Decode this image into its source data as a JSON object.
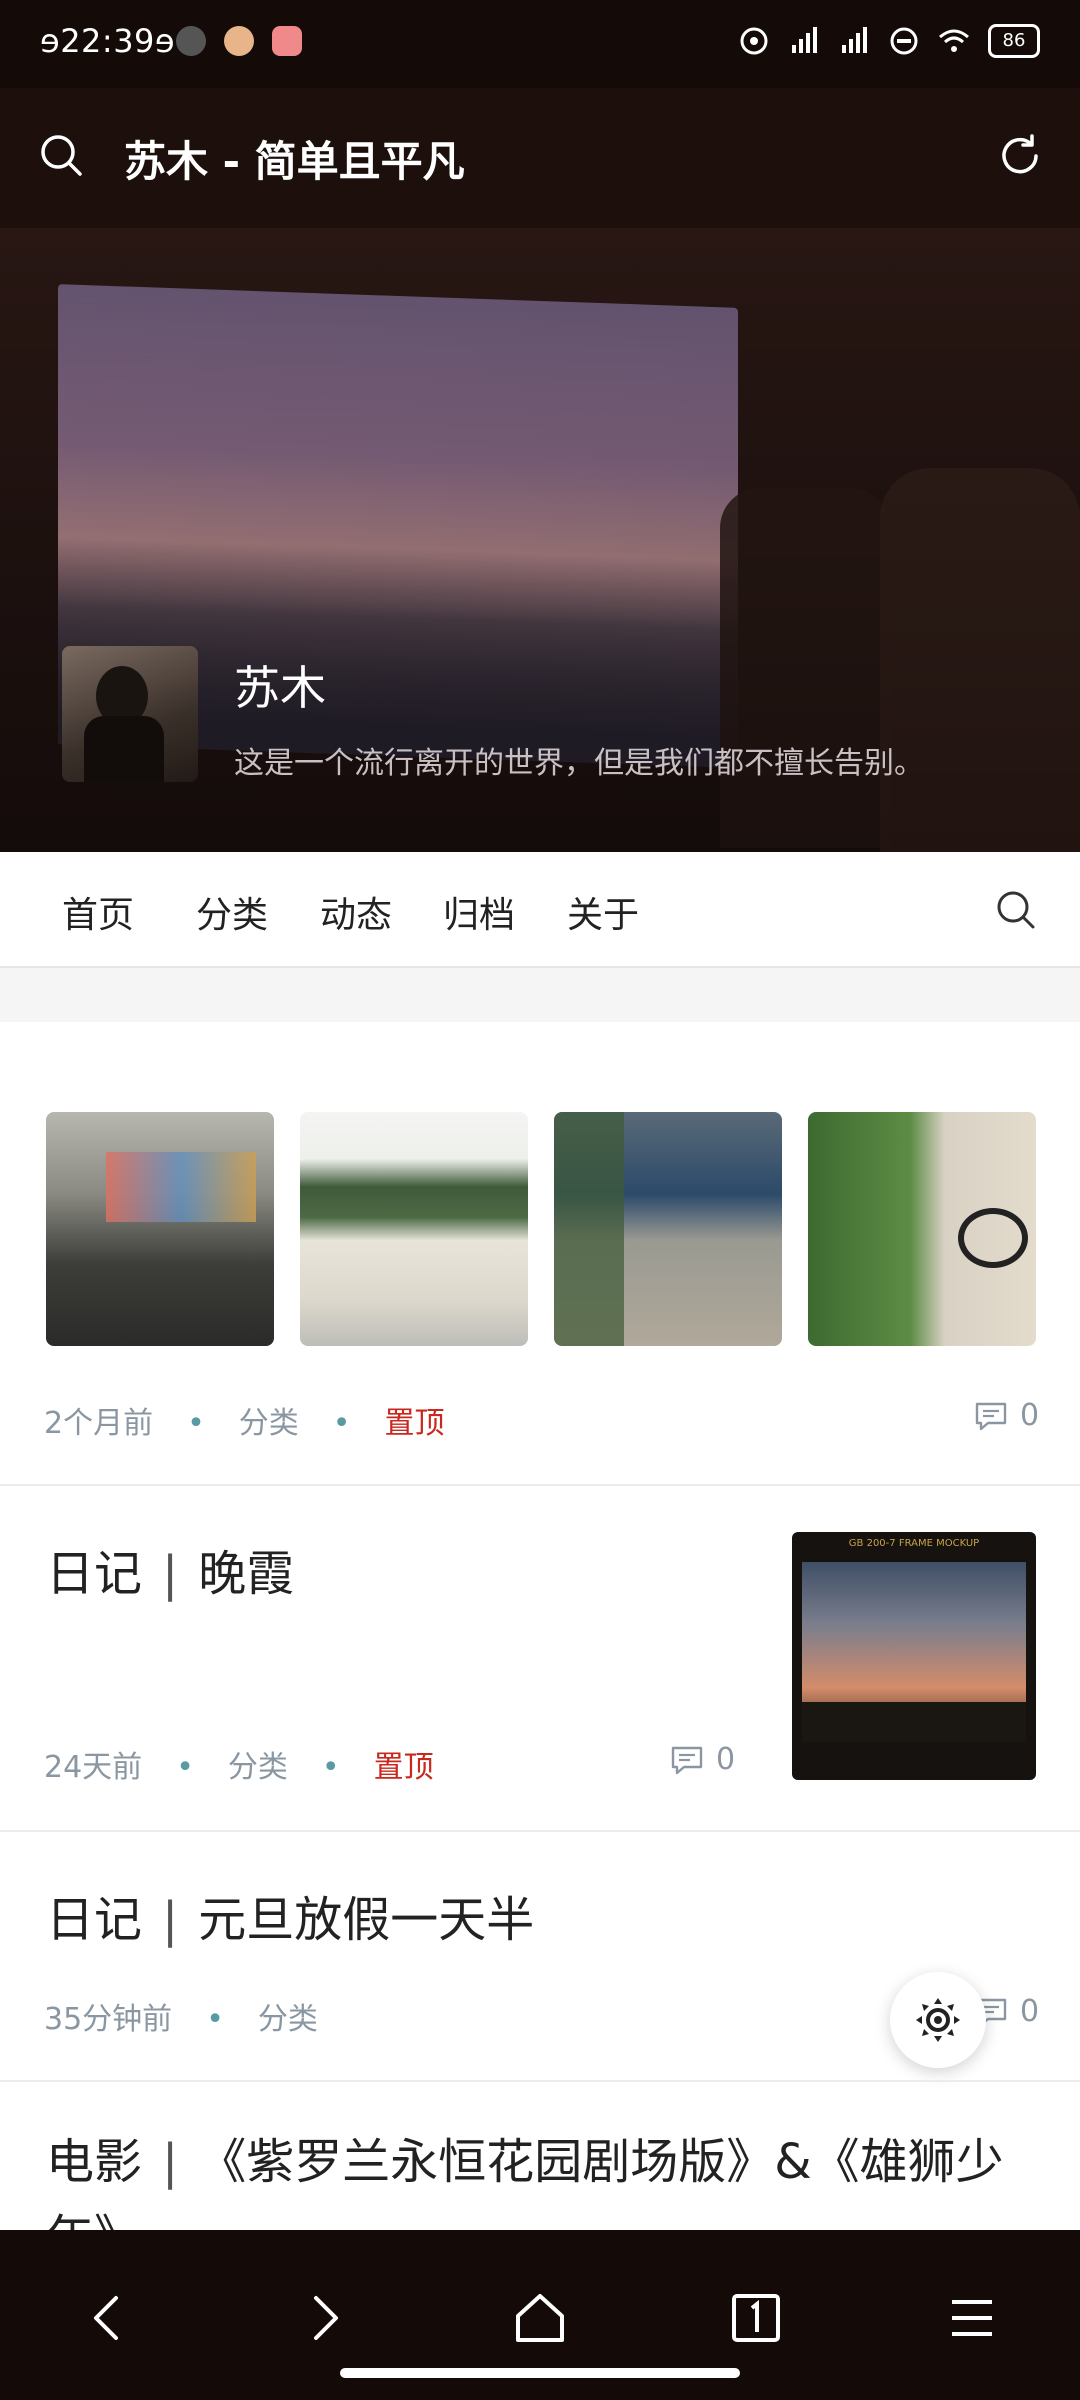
{
  "status": {
    "time": "ɘ22:39ɘ",
    "battery": "86"
  },
  "appbar": {
    "title": "苏木 - 简单且平凡"
  },
  "profile": {
    "name": "苏木",
    "bio": "这是一个流行离开的世界，但是我们都不擅长告别。"
  },
  "nav": {
    "items": [
      "首页",
      "分类",
      "动态",
      "归档",
      "关于"
    ]
  },
  "posts": [
    {
      "time": "2个月前",
      "category": "分类",
      "pinned": "置顶",
      "comments": "0"
    },
    {
      "title_a": "日记",
      "title_b": "晚霞",
      "time": "24天前",
      "category": "分类",
      "pinned": "置顶",
      "comments": "0"
    },
    {
      "title_a": "日记",
      "title_b": "元旦放假一天半",
      "time": "35分钟前",
      "category": "分类",
      "comments": "0"
    },
    {
      "title_a": "电影",
      "title_b": "《紫罗兰永恒花园剧场版》&《雄狮少年》"
    }
  ],
  "cover_header": "GB 200-7 FRAME MOCKUP",
  "colors": {
    "accent_pin": "#c9281e",
    "meta": "#8a97a3",
    "dark_bar": "#140a08"
  }
}
